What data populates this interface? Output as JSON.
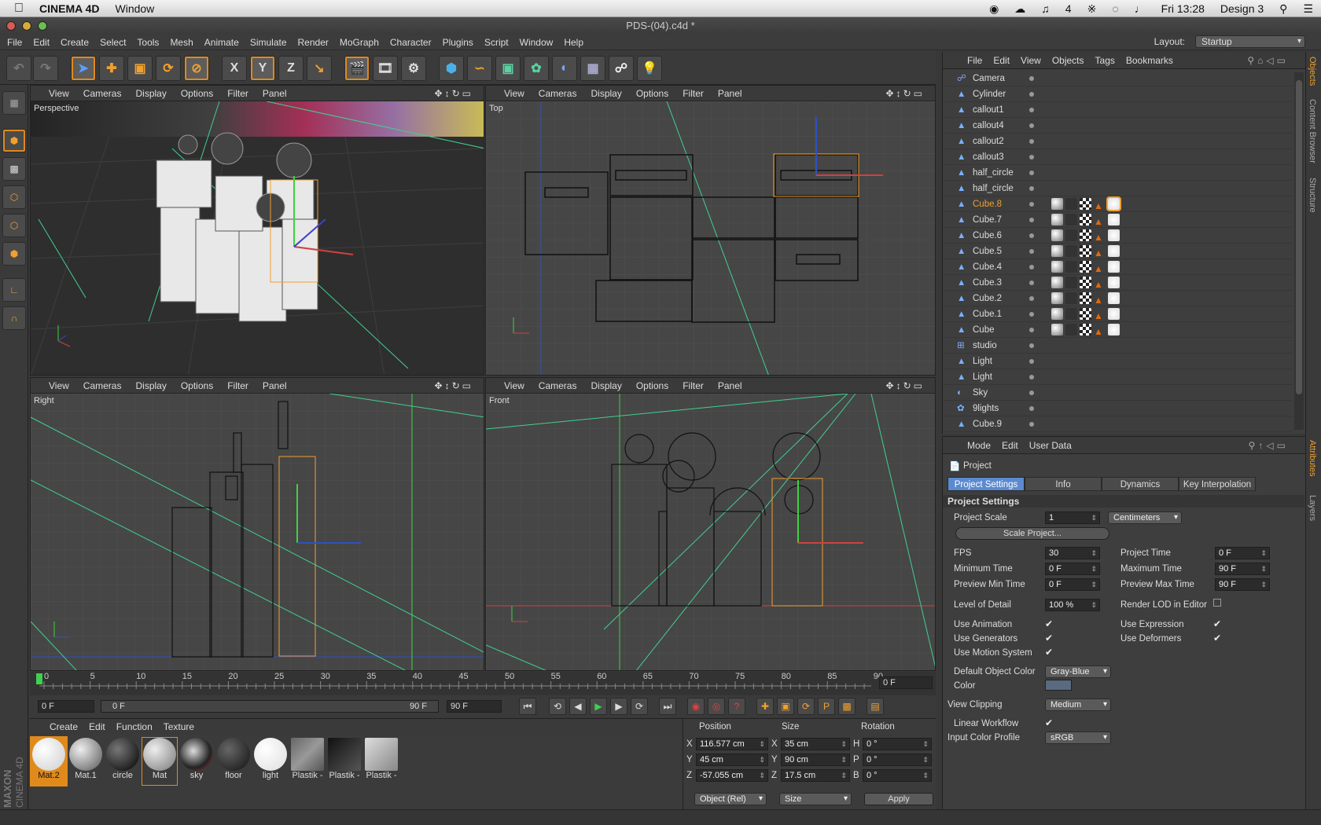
{
  "osx": {
    "app": "CINEMA 4D",
    "menu": "Window",
    "status": [
      "4"
    ],
    "clock": "Fri 13:28",
    "user": "Design 3"
  },
  "window": {
    "title": "PDS-(04).c4d *"
  },
  "menu": [
    "File",
    "Edit",
    "Create",
    "Select",
    "Tools",
    "Mesh",
    "Animate",
    "Simulate",
    "Render",
    "MoGraph",
    "Character",
    "Plugins",
    "Script",
    "Window",
    "Help"
  ],
  "layout": {
    "label": "Layout:",
    "value": "Startup"
  },
  "toolbar": {
    "axis_x": "X",
    "axis_y": "Y",
    "axis_z": "Z"
  },
  "viewport_menu": [
    "View",
    "Cameras",
    "Display",
    "Options",
    "Filter",
    "Panel"
  ],
  "viewports": {
    "perspective": "Perspective",
    "top": "Top",
    "right": "Right",
    "front": "Front"
  },
  "timeline": {
    "ticks": [
      "0",
      "5",
      "10",
      "15",
      "20",
      "25",
      "30",
      "35",
      "40",
      "45",
      "50",
      "55",
      "60",
      "65",
      "70",
      "75",
      "80",
      "85",
      "90"
    ],
    "current": "0 F"
  },
  "playbar": {
    "start": "0 F",
    "range_start": "0 F",
    "range_end": "90 F",
    "end": "90 F"
  },
  "materials": {
    "menu": [
      "Create",
      "Edit",
      "Function",
      "Texture"
    ],
    "items": [
      "Mat.2",
      "Mat.1",
      "circle",
      "Mat",
      "sky",
      "floor",
      "light",
      "Plastik -",
      "Plastik -",
      "Plastik -"
    ]
  },
  "coords": {
    "headers": [
      "Position",
      "Size",
      "Rotation"
    ],
    "rows": [
      {
        "axis": "X",
        "pos": "116.577 cm",
        "saxis": "X",
        "size": "35 cm",
        "raxis": "H",
        "rot": "0 °"
      },
      {
        "axis": "Y",
        "pos": "45 cm",
        "saxis": "Y",
        "size": "90 cm",
        "raxis": "P",
        "rot": "0 °"
      },
      {
        "axis": "Z",
        "pos": "-57.055 cm",
        "saxis": "Z",
        "size": "17.5 cm",
        "raxis": "B",
        "rot": "0 °"
      }
    ],
    "mode": "Object (Rel)",
    "sizemode": "Size",
    "apply": "Apply"
  },
  "maxon": {
    "line1": "MAXON",
    "line2": "CINEMA 4D"
  },
  "objects": {
    "menu": [
      "File",
      "Edit",
      "View",
      "Objects",
      "Tags",
      "Bookmarks"
    ],
    "rows": [
      {
        "name": "Camera"
      },
      {
        "name": "Cylinder"
      },
      {
        "name": "callout1"
      },
      {
        "name": "callout4"
      },
      {
        "name": "callout2"
      },
      {
        "name": "callout3"
      },
      {
        "name": "half_circle"
      },
      {
        "name": "half_circle"
      },
      {
        "name": "Cube.8"
      },
      {
        "name": "Cube.7"
      },
      {
        "name": "Cube.6"
      },
      {
        "name": "Cube.5"
      },
      {
        "name": "Cube.4"
      },
      {
        "name": "Cube.3"
      },
      {
        "name": "Cube.2"
      },
      {
        "name": "Cube.1"
      },
      {
        "name": "Cube"
      },
      {
        "name": "studio"
      },
      {
        "name": "Light"
      },
      {
        "name": "Light"
      },
      {
        "name": "Sky"
      },
      {
        "name": "9lights"
      },
      {
        "name": "Cube.9"
      }
    ]
  },
  "attributes": {
    "menu": [
      "Mode",
      "Edit",
      "User Data"
    ],
    "title": "Project",
    "tabs": [
      "Project Settings",
      "Info",
      "Dynamics",
      "Key Interpolation"
    ],
    "section": "Project Settings",
    "project_scale": {
      "label": "Project Scale",
      "value": "1",
      "unit": "Centimeters"
    },
    "scale_button": "Scale Project...",
    "fps": {
      "label": "FPS",
      "value": "30"
    },
    "project_time": {
      "label": "Project Time",
      "value": "0 F"
    },
    "min_time": {
      "label": "Minimum Time",
      "value": "0 F"
    },
    "max_time": {
      "label": "Maximum Time",
      "value": "90 F"
    },
    "prev_min": {
      "label": "Preview Min Time",
      "value": "0 F"
    },
    "prev_max": {
      "label": "Preview Max Time",
      "value": "90 F"
    },
    "lod": {
      "label": "Level of Detail",
      "value": "100 %"
    },
    "render_lod": "Render LOD in Editor",
    "use_anim": "Use Animation",
    "use_expr": "Use Expression",
    "use_gen": "Use Generators",
    "use_def": "Use Deformers",
    "use_motion": "Use Motion System",
    "def_color": {
      "label": "Default Object Color",
      "value": "Gray-Blue"
    },
    "color": "Color",
    "clipping": {
      "label": "View Clipping",
      "value": "Medium"
    },
    "linear": "Linear Workflow",
    "profile": {
      "label": "Input Color Profile",
      "value": "sRGB"
    }
  },
  "side_tabs": [
    "Objects",
    "Content Browser",
    "Structure",
    "Attributes",
    "Layers"
  ]
}
